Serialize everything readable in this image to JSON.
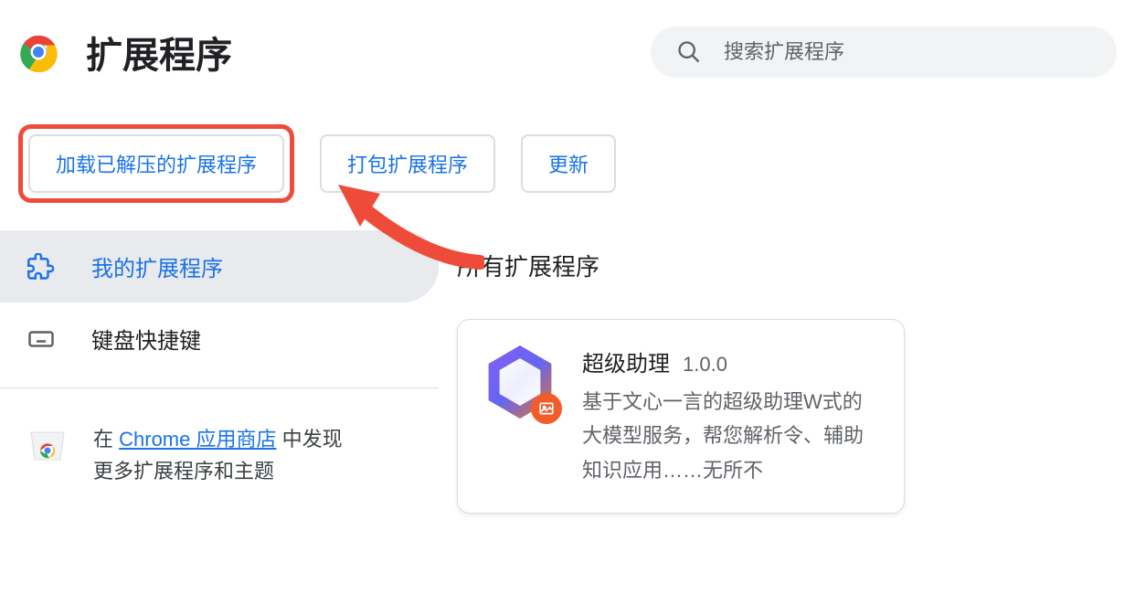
{
  "header": {
    "title": "扩展程序",
    "search_placeholder": "搜索扩展程序"
  },
  "buttons": {
    "load_unpacked": "加载已解压的扩展程序",
    "pack": "打包扩展程序",
    "update": "更新"
  },
  "sidebar": {
    "my_extensions": "我的扩展程序",
    "keyboard_shortcuts": "键盘快捷键"
  },
  "store": {
    "prefix": "在 ",
    "link": "Chrome 应用商店",
    "suffix": " 中发现",
    "line2": "更多扩展程序和主题"
  },
  "content": {
    "section_title": "所有扩展程序"
  },
  "extension": {
    "name": "超级助理",
    "version": "1.0.0",
    "desc": "基于文心一言的超级助理W式的大模型服务，帮您解析令、辅助知识应用……无所不"
  },
  "colors": {
    "accent": "#1a73e8",
    "highlight": "#ef4b3a"
  }
}
